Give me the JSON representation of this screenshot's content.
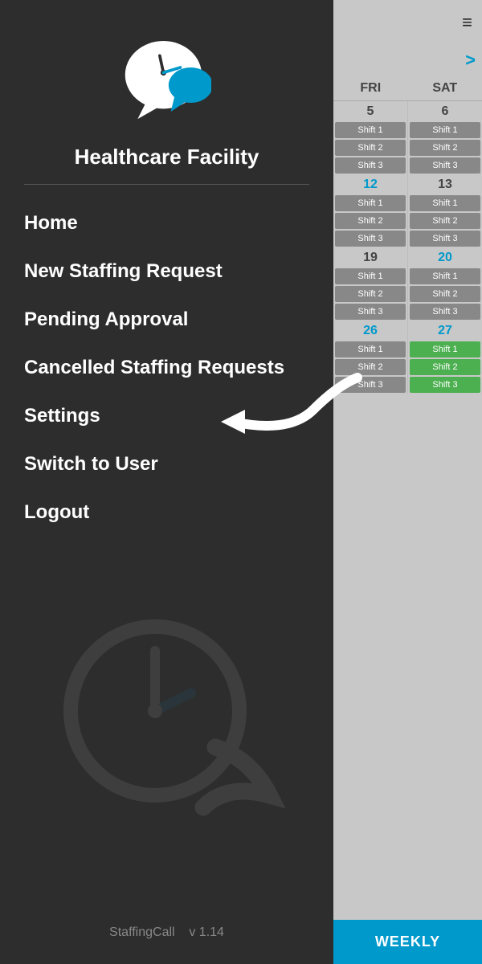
{
  "app": {
    "name": "StaffingCall",
    "version": "v 1.14"
  },
  "sidebar": {
    "facility_name": "Healthcare Facility",
    "nav_items": [
      {
        "id": "home",
        "label": "Home"
      },
      {
        "id": "new-staffing-request",
        "label": "New Staffing Request"
      },
      {
        "id": "pending-approval",
        "label": "Pending Approval"
      },
      {
        "id": "cancelled-staffing-requests",
        "label": "Cancelled Staffing Requests"
      },
      {
        "id": "settings",
        "label": "Settings"
      },
      {
        "id": "switch-to-user",
        "label": "Switch to User"
      },
      {
        "id": "logout",
        "label": "Logout"
      }
    ]
  },
  "calendar": {
    "nav_arrow": ">",
    "columns": [
      "FRI",
      "SAT"
    ],
    "weeks": [
      {
        "dates": [
          "5",
          "6"
        ],
        "date_classes": [
          "normal",
          "normal"
        ],
        "shifts": [
          [
            "Shift 1",
            "Shift 2",
            "Shift 3"
          ],
          [
            "Shift 1",
            "Shift 2",
            "Shift 3"
          ]
        ],
        "shift_classes": [
          [
            "normal",
            "normal",
            "normal"
          ],
          [
            "normal",
            "normal",
            "normal"
          ]
        ]
      },
      {
        "dates": [
          "12",
          "13"
        ],
        "date_classes": [
          "blue",
          "normal"
        ],
        "shifts": [
          [
            "Shift 1",
            "Shift 2",
            "Shift 3"
          ],
          [
            "Shift 1",
            "Shift 2",
            "Shift 3"
          ]
        ],
        "shift_classes": [
          [
            "normal",
            "normal",
            "normal"
          ],
          [
            "normal",
            "normal",
            "normal"
          ]
        ]
      },
      {
        "dates": [
          "19",
          "20"
        ],
        "date_classes": [
          "normal",
          "blue"
        ],
        "shifts": [
          [
            "Shift 1",
            "Shift 2",
            "Shift 3"
          ],
          [
            "Shift 1",
            "Shift 2",
            "Shift 3"
          ]
        ],
        "shift_classes": [
          [
            "normal",
            "normal",
            "normal"
          ],
          [
            "normal",
            "normal",
            "normal"
          ]
        ]
      },
      {
        "dates": [
          "26",
          "27"
        ],
        "date_classes": [
          "blue",
          "blue"
        ],
        "shifts": [
          [
            "Shift 1",
            "Shift 2",
            "Shift 3"
          ],
          [
            "Shift 1",
            "Shift 2",
            "Shift 3"
          ]
        ],
        "shift_classes": [
          [
            "normal",
            "normal",
            "normal"
          ],
          [
            "green",
            "green",
            "green"
          ]
        ]
      }
    ],
    "bottom_tab": "WEEKLY"
  }
}
